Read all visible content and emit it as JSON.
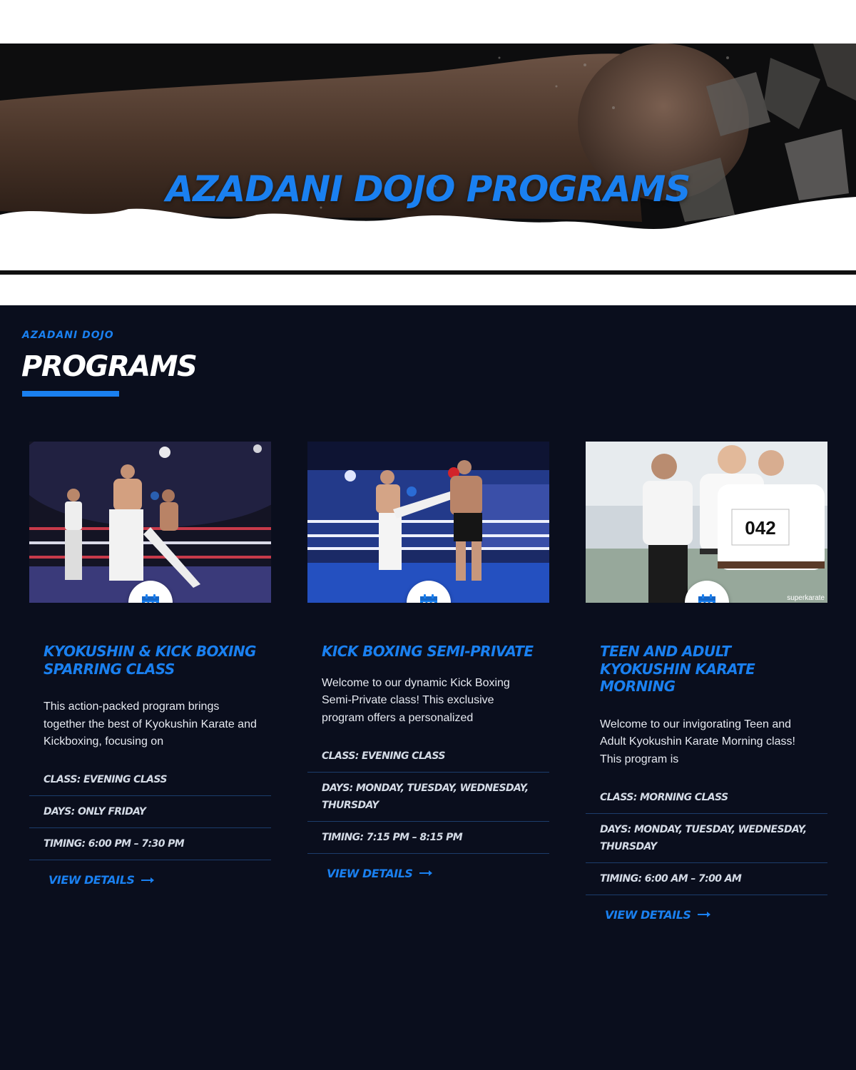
{
  "hero": {
    "title": "AZADANI DOJO PROGRAMS"
  },
  "programs": {
    "eyebrow": "AZADANI DOJO",
    "title": "PROGRAMS",
    "accent_color": "#1a80f0",
    "background_color": "#0a0e1d",
    "cards": [
      {
        "title": "KYOKUSHIN & KICK BOXING SPARRING CLASS",
        "description": "This action-packed program brings together the best of Kyokushin Karate and Kickboxing, focusing on",
        "class": "CLASS: EVENING CLASS",
        "days": "DAYS: ONLY FRIDAY",
        "timing": "TIMING: 6:00 PM – 7:30 PM",
        "cta": "VIEW DETAILS",
        "icon": "calendar-icon"
      },
      {
        "title": "KICK BOXING SEMI-PRIVATE",
        "description": "Welcome to our dynamic Kick Boxing Semi-Private class! This exclusive program offers a personalized",
        "class": "CLASS: EVENING CLASS",
        "days": "DAYS: MONDAY, TUESDAY, WEDNESDAY, THURSDAY",
        "timing": "TIMING: 7:15 PM – 8:15 PM",
        "cta": "VIEW DETAILS",
        "icon": "calendar-icon"
      },
      {
        "title": "TEEN AND ADULT KYOKUSHIN KARATE MORNING",
        "description": "Welcome to our invigorating Teen and Adult Kyokushin Karate Morning class! This program is",
        "class": "CLASS: MORNING CLASS",
        "days": "DAYS: MONDAY, TUESDAY, WEDNESDAY, THURSDAY",
        "timing": "TIMING: 6:00 AM – 7:00 AM",
        "cta": "VIEW DETAILS",
        "icon": "calendar-icon",
        "photo_watermark": "superkarate",
        "bib_number": "042"
      }
    ]
  }
}
